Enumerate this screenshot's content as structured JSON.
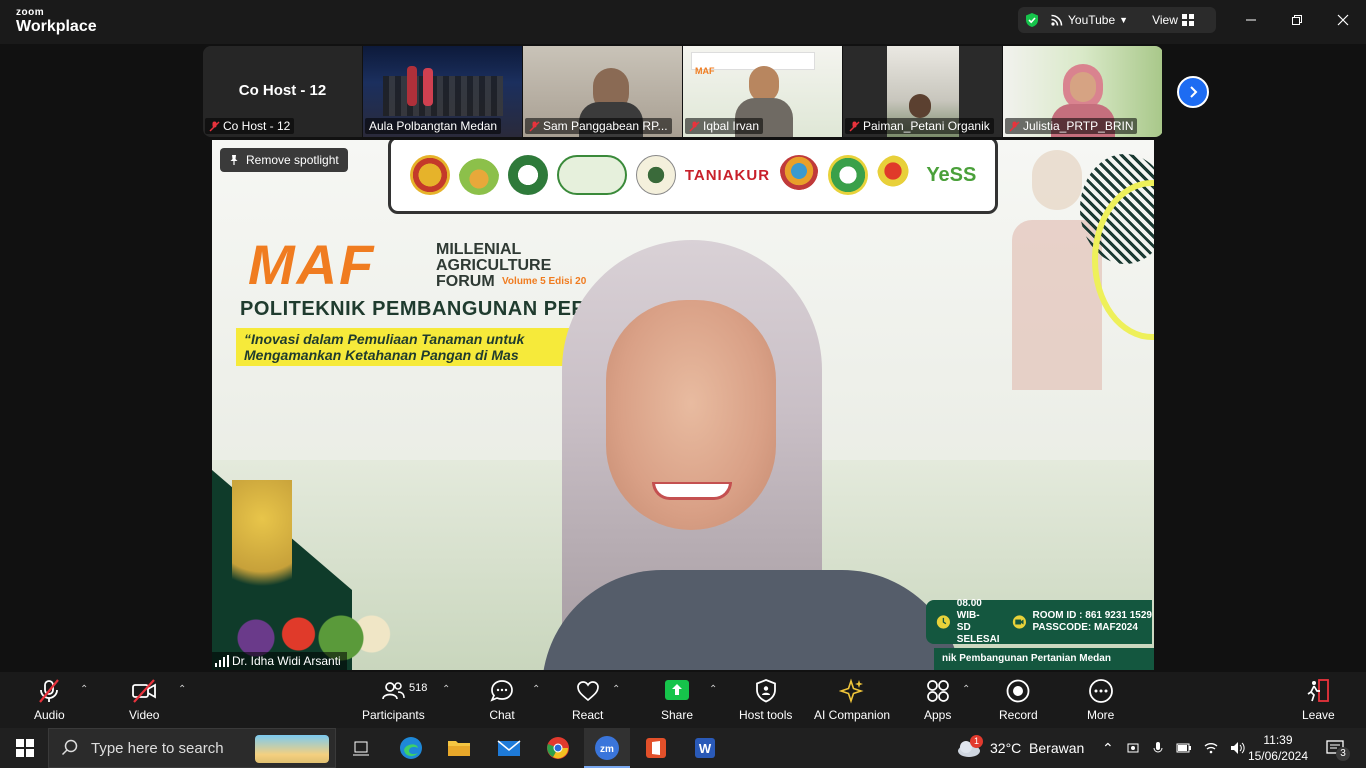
{
  "titlebar": {
    "brand_small": "zoom",
    "brand_big": "Workplace",
    "youtube_label": "YouTube",
    "view_label": "View"
  },
  "participants_strip": {
    "cohost_title": "Co Host - 12",
    "thumbs": [
      {
        "name": "Co Host - 12"
      },
      {
        "name": "Aula Polbangtan Medan"
      },
      {
        "name": "Sam Panggabean RP..."
      },
      {
        "name": "Iqbal Irvan"
      },
      {
        "name": "Paiman_Petani Organik"
      },
      {
        "name": "Julistia_PRTP_BRIN"
      }
    ]
  },
  "main_video": {
    "spotlight_label": "Remove spotlight",
    "speaker_name": "Dr. Idha Widi Arsanti",
    "banner": {
      "tani_akur": "TANIAKUR",
      "maf_big": "MAF",
      "maf_forum_line1": "MILLENIAL",
      "maf_forum_line2": "AGRICULTURE",
      "maf_forum_line3": "FORUM",
      "maf_volume": "Volume 5 Edisi 20",
      "poltek": "POLITEKNIK PEMBANGUNAN PERTANIAN ME",
      "tagline_1": "“Inovasi dalam Pemuliaan Tanaman untuk",
      "tagline_2": "Mengamankan Ketahanan Pangan di Mas",
      "time_1": "08.00 WIB-",
      "time_2": "SD SELESAI",
      "room_id": "ROOM ID : 861 9231 1529",
      "passcode": "PASSCODE: MAF2024",
      "footer": "nik Pembangunan Pertanian Medan"
    }
  },
  "toolbar": {
    "audio": "Audio",
    "video": "Video",
    "participants": "Participants",
    "participants_count": "518",
    "chat": "Chat",
    "react": "React",
    "share": "Share",
    "host_tools": "Host tools",
    "ai_companion": "AI Companion",
    "apps": "Apps",
    "record": "Record",
    "more": "More",
    "leave": "Leave"
  },
  "taskbar": {
    "search_placeholder": "Type here to search",
    "weather": "32°C  Berawan",
    "weather_badge": "1",
    "time": "11:39",
    "date": "15/06/2024",
    "notif_count": "3"
  },
  "colors": {
    "accent_blue": "#1d6cf2",
    "share_green": "#16c44b",
    "mute_red": "#e8323c",
    "maf_orange": "#f07c20"
  }
}
